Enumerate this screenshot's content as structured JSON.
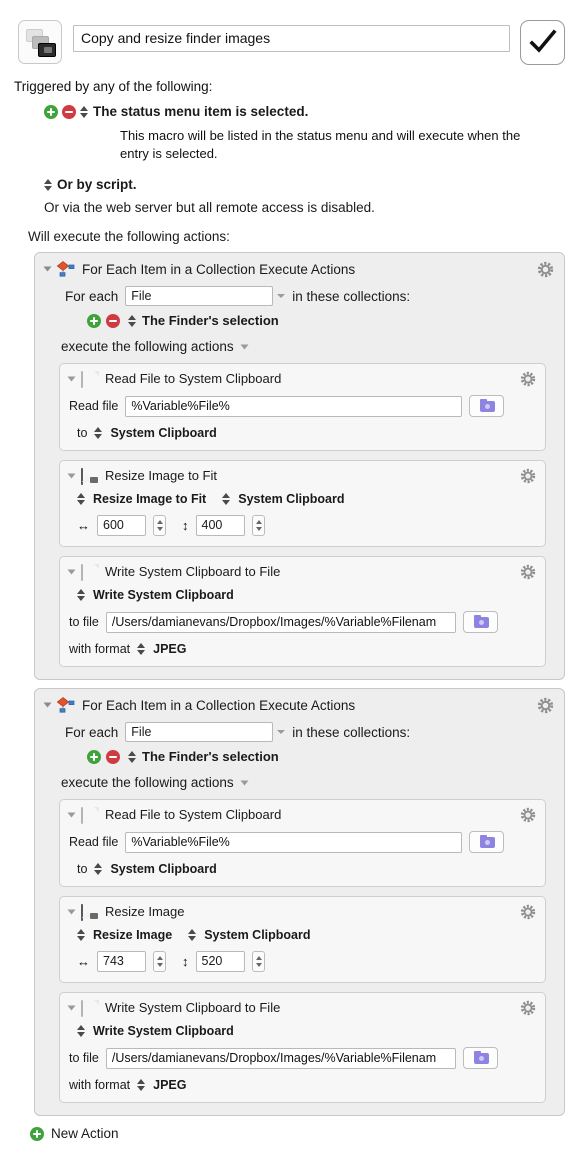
{
  "header": {
    "macro_icon": "stacked-screens-icon",
    "title_value": "Copy and resize finder images",
    "confirm_icon": "checkmark-icon"
  },
  "triggers": {
    "heading": "Triggered by any of the following:",
    "add_icon": "plus-circle-icon",
    "remove_icon": "minus-circle-icon",
    "stepper_icon": "up-down-stepper-icon",
    "items": [
      {
        "label": "The status menu item is selected.",
        "description": "This macro will be listed in the status menu and will execute when the entry is selected."
      },
      {
        "label": "Or by script.",
        "description": ""
      }
    ],
    "web_server_note": "Or via the web server but all remote access is disabled."
  },
  "actions_heading": "Will execute the following actions:",
  "groups": [
    {
      "title": "For Each Item in a Collection Execute Actions",
      "icon": "flow-diamond-icon",
      "gear_icon": "gear-icon",
      "disclosure_icon": "disclosure-triangle-icon",
      "for_each_label": "For each",
      "for_each_value": "File",
      "in_collections_label": "in these collections:",
      "collection_value": "The Finder's selection",
      "execute_label": "execute the following actions",
      "actions": [
        {
          "title": "Read File to System Clipboard",
          "icon": "document-icon",
          "gear_icon": "gear-icon",
          "field_label": "Read file",
          "field_value": "%Variable%File%",
          "browse_icon": "folder-icon",
          "dest_label": "to",
          "dest_value": "System Clipboard"
        },
        {
          "title": "Resize Image to Fit",
          "icon": "image-icon",
          "gear_icon": "gear-icon",
          "mode_value": "Resize Image to Fit",
          "source_value": "System Clipboard",
          "width_icon": "horizontal-arrow-icon",
          "width_value": "600",
          "height_icon": "vertical-arrow-icon",
          "height_value": "400",
          "stepper_icon": "stepper-icon"
        },
        {
          "title": "Write System Clipboard to File",
          "icon": "document-icon",
          "gear_icon": "gear-icon",
          "source_value": "Write System Clipboard",
          "field_label": "to file",
          "field_value": "/Users/damianevans/Dropbox/Images/%Variable%Filenam",
          "browse_icon": "folder-icon",
          "format_label": "with format",
          "format_value": "JPEG"
        }
      ]
    },
    {
      "title": "For Each Item in a Collection Execute Actions",
      "icon": "flow-diamond-icon",
      "gear_icon": "gear-icon",
      "disclosure_icon": "disclosure-triangle-icon",
      "for_each_label": "For each",
      "for_each_value": "File",
      "in_collections_label": "in these collections:",
      "collection_value": "The Finder's selection",
      "execute_label": "execute the following actions",
      "actions": [
        {
          "title": "Read File to System Clipboard",
          "icon": "document-icon",
          "gear_icon": "gear-icon",
          "field_label": "Read file",
          "field_value": "%Variable%File%",
          "browse_icon": "folder-icon",
          "dest_label": "to",
          "dest_value": "System Clipboard"
        },
        {
          "title": "Resize Image",
          "icon": "image-icon",
          "gear_icon": "gear-icon",
          "mode_value": "Resize Image",
          "source_value": "System Clipboard",
          "width_icon": "horizontal-arrow-icon",
          "width_value": "743",
          "height_icon": "vertical-arrow-icon",
          "height_value": "520",
          "stepper_icon": "stepper-icon"
        },
        {
          "title": "Write System Clipboard to File",
          "icon": "document-icon",
          "gear_icon": "gear-icon",
          "source_value": "Write System Clipboard",
          "field_label": "to file",
          "field_value": "/Users/damianevans/Dropbox/Images/%Variable%Filenam",
          "browse_icon": "folder-icon",
          "format_label": "with format",
          "format_value": "JPEG"
        }
      ]
    }
  ],
  "footer": {
    "new_action_label": "New Action",
    "new_action_icon": "plus-circle-icon"
  },
  "glyphs": {
    "arrow_horizontal": "↔",
    "arrow_vertical": "↕"
  },
  "colors": {
    "add_green": "#3ea33c",
    "remove_red": "#cf3b41",
    "folder_purple": "#8d84e2",
    "group_bg": "#efeeee",
    "action_bg": "#f7f7f7"
  }
}
